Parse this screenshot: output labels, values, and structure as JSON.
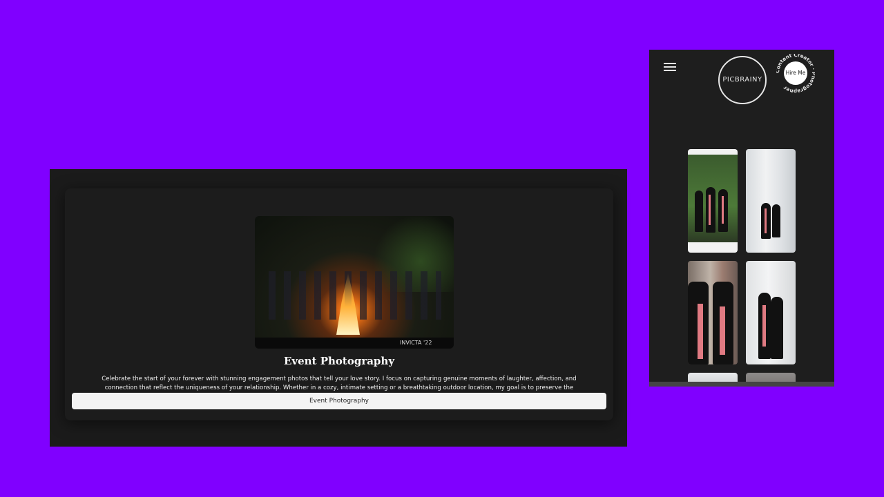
{
  "event_panel": {
    "image_alt": "Group of people dancing around a bonfire at night",
    "image_caption": "INVICTA '22",
    "title": "Event Photography",
    "description": "Celebrate the start of your forever with stunning engagement photos that tell your love story. I focus on capturing genuine moments of laughter, affection, and connection that reflect the uniqueness of your relationship. Whether in a cozy, intimate setting or a breathtaking outdoor location, my goal is to preserve the excitement, joy, and romance of this special chapter in your lives. Let's create timeless images that will remind you of the beautiful journey you're about to embark on—together.",
    "button_label": "Event Photography"
  },
  "mobile_panel": {
    "menu_icon": "hamburger-menu-icon",
    "logo_text": "PICBRAINY",
    "badge_ring_text": "Content Creator · Photographer",
    "hire_label": "Hire Me"
  },
  "colors": {
    "page_background": "#8000ff",
    "panel_background": "#1b1b1b",
    "button_background": "#f4f4f4"
  }
}
